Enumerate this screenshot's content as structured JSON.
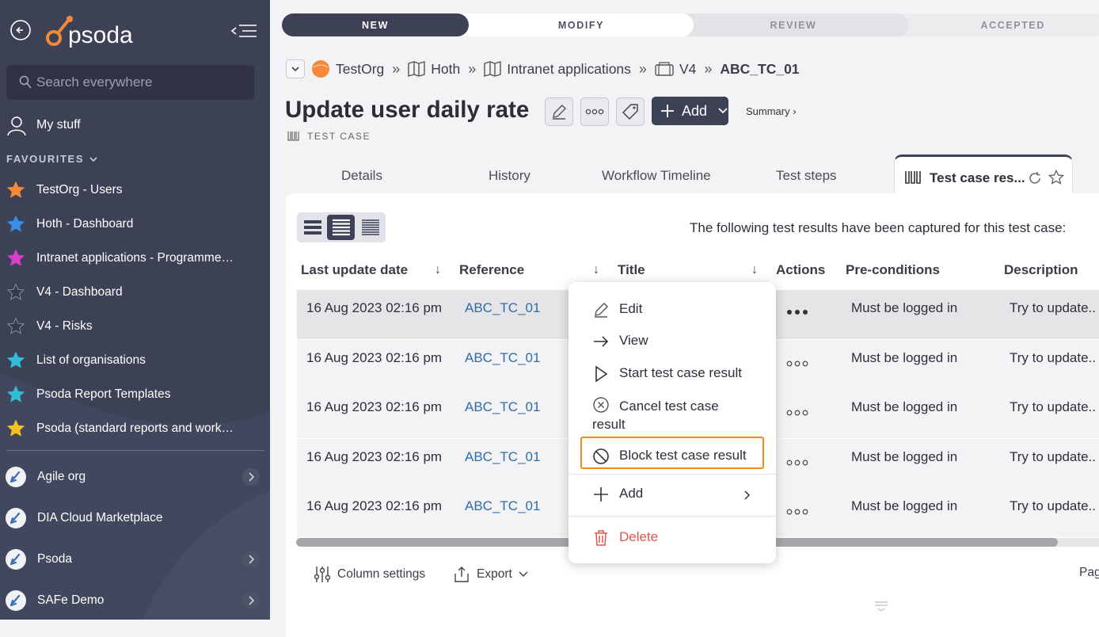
{
  "sidebar": {
    "search_placeholder": "Search everywhere",
    "my_stuff": "My stuff",
    "favourites_heading": "FAVOURITES",
    "favourites": [
      {
        "label": "TestOrg - Users",
        "color": "#f5893a"
      },
      {
        "label": "Hoth - Dashboard",
        "color": "#3b8ee8"
      },
      {
        "label": "Intranet applications - Programme…",
        "color": "#d83fc9"
      },
      {
        "label": "V4 - Dashboard",
        "color": "#353a4b"
      },
      {
        "label": "V4 - Risks",
        "color": "#353a4b"
      },
      {
        "label": "List of organisations",
        "color": "#33bcd6"
      },
      {
        "label": "Psoda Report Templates",
        "color": "#33bcd6"
      },
      {
        "label": "Psoda (standard reports and work…",
        "color": "#f2c024"
      }
    ],
    "orgs": [
      {
        "label": "Agile org",
        "has_children": true
      },
      {
        "label": "DIA Cloud Marketplace",
        "has_children": false
      },
      {
        "label": "Psoda",
        "has_children": true
      },
      {
        "label": "SAFe Demo",
        "has_children": true
      }
    ]
  },
  "workflow": {
    "stages": [
      "NEW",
      "MODIFY",
      "REVIEW",
      "ACCEPTED"
    ],
    "current": "NEW",
    "next": "MODIFY"
  },
  "breadcrumb": {
    "items": [
      "TestOrg",
      "Hoth",
      "Intranet applications",
      "V4"
    ],
    "current": "ABC_TC_01"
  },
  "page": {
    "title": "Update user daily rate",
    "add_label": "Add",
    "summary_label": "Summary ›",
    "type_label": "TEST CASE"
  },
  "tabs": [
    "Details",
    "History",
    "Workflow Timeline",
    "Test steps",
    "Test case res..."
  ],
  "panel": {
    "caption": "The following test results have been captured for this test case:",
    "columns": [
      "Last update date",
      "Reference",
      "Title",
      "Actions",
      "Pre-conditions",
      "Description"
    ],
    "rows": [
      {
        "date": "16 Aug 2023 02:16 pm",
        "ref": "ABC_TC_01",
        "pre": "Must be logged in",
        "desc": "Try to update.."
      },
      {
        "date": "16 Aug 2023 02:16 pm",
        "ref": "ABC_TC_01",
        "pre": "Must be logged in",
        "desc": "Try to update.."
      },
      {
        "date": "16 Aug 2023 02:16 pm",
        "ref": "ABC_TC_01",
        "pre": "Must be logged in",
        "desc": "Try to update.."
      },
      {
        "date": "16 Aug 2023 02:16 pm",
        "ref": "ABC_TC_01",
        "pre": "Must be logged in",
        "desc": "Try to update.."
      },
      {
        "date": "16 Aug 2023 02:16 pm",
        "ref": "ABC_TC_01",
        "pre": "Must be logged in",
        "desc": "Try to update.."
      }
    ],
    "column_settings": "Column settings",
    "export": "Export",
    "pagination": "Pag"
  },
  "context_menu": {
    "edit": "Edit",
    "view": "View",
    "start": "Start test case result",
    "cancel_line1": "Cancel test case",
    "cancel_line2": "result",
    "block": "Block test case result",
    "add": "Add",
    "delete": "Delete"
  },
  "colors": {
    "sidebar": "#3c4155",
    "accent_link": "#2e6da8",
    "highlight": "#f08a1a",
    "danger": "#e0564f",
    "brand_orange": "#f5893a"
  }
}
